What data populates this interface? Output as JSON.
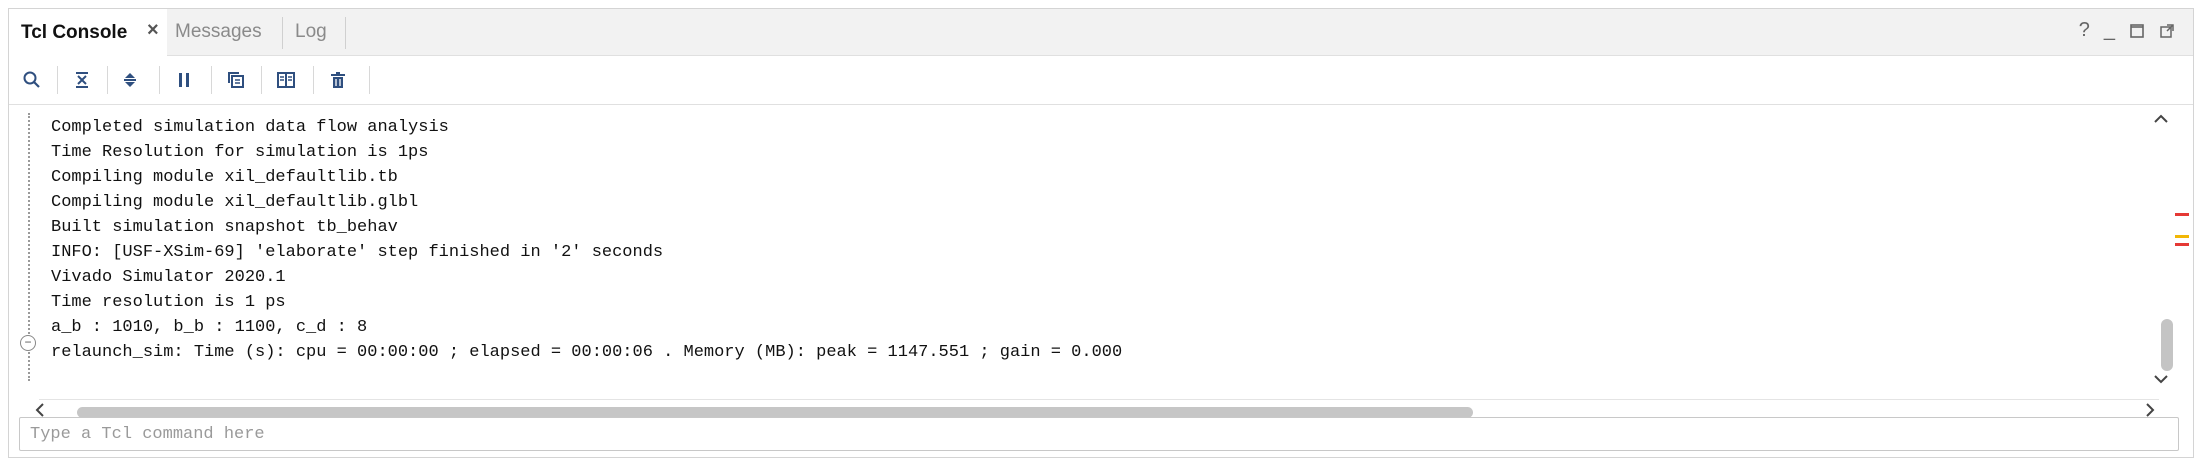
{
  "tabs": [
    {
      "label": "Tcl Console",
      "active": true
    },
    {
      "label": "Messages",
      "active": false
    },
    {
      "label": "Log",
      "active": false
    }
  ],
  "window_controls": {
    "help": "?",
    "minimize": "_"
  },
  "toolbar": {
    "icons": [
      "search-icon",
      "collapse-all-icon",
      "expand-all-icon",
      "pause-icon",
      "copy-icon",
      "split-view-icon",
      "clear-icon"
    ]
  },
  "console": {
    "lines": [
      "Completed simulation data flow analysis",
      "Time Resolution for simulation is 1ps",
      "Compiling module xil_defaultlib.tb",
      "Compiling module xil_defaultlib.glbl",
      "Built simulation snapshot tb_behav",
      "INFO: [USF-XSim-69] 'elaborate' step finished in '2' seconds",
      "Vivado Simulator 2020.1",
      "Time resolution is 1 ps",
      "a_b : 1010, b_b : 1100, c_d : 8",
      "relaunch_sim: Time (s): cpu = 00:00:00 ; elapsed = 00:00:06 . Memory (MB): peak = 1147.551 ; gain = 0.000"
    ]
  },
  "command_input": {
    "value": "",
    "placeholder": "Type a Tcl command here"
  },
  "colors": {
    "error_marker": "#e53935",
    "warning_marker": "#f2b705"
  }
}
